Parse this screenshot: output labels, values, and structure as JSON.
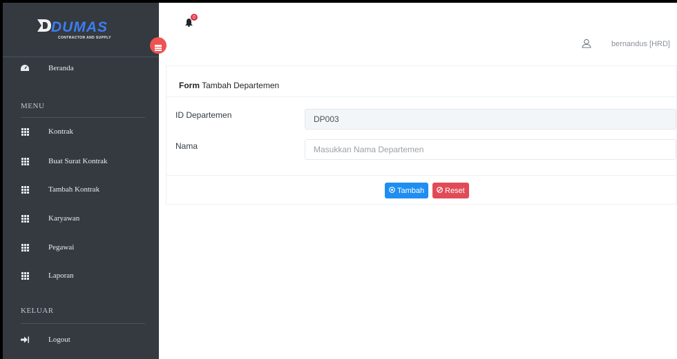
{
  "brand": {
    "name": "DUMAS",
    "tagline": "CONTRACTOR AND SUPPLY"
  },
  "sidebar": {
    "top_item": {
      "label": "Beranda",
      "icon": "dashboard-icon"
    },
    "menu_header": "MENU",
    "items": [
      {
        "label": "Kontrak",
        "icon": "grid-icon"
      },
      {
        "label": "Buat Surat Kontrak",
        "icon": "grid-icon"
      },
      {
        "label": "Tambah Kontrak",
        "icon": "grid-icon"
      },
      {
        "label": "Karyawan",
        "icon": "grid-icon"
      },
      {
        "label": "Pegawai",
        "icon": "grid-icon"
      },
      {
        "label": "Laporan",
        "icon": "grid-icon"
      }
    ],
    "logout_header": "KELUAR",
    "logout": {
      "label": "Logout",
      "icon": "logout-icon"
    }
  },
  "topbar": {
    "notification_count": "0",
    "user": "bernandus [HRD]"
  },
  "form": {
    "title_bold": "Form",
    "title_rest": " Tambah Departemen",
    "fields": [
      {
        "label": "ID Departemen",
        "value": "DP003",
        "placeholder": ""
      },
      {
        "label": "Nama",
        "value": "",
        "placeholder": "Masukkan Nama Departemen"
      }
    ],
    "submit_label": "Tambah",
    "reset_label": "Reset"
  },
  "colors": {
    "sidebar_bg": "#343a40",
    "primary": "#1f8ef1",
    "danger": "#e14b57",
    "brand_blue": "#3d7df2",
    "badge": "#dc3545"
  }
}
